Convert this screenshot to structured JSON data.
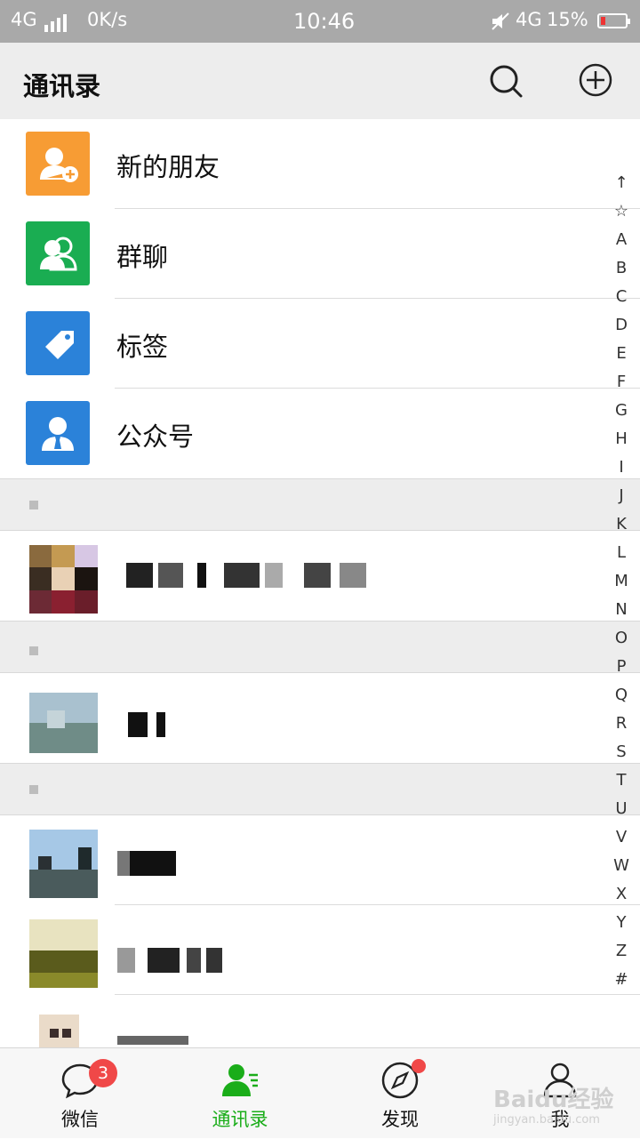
{
  "status_bar": {
    "network_left": "4G",
    "speed": "0K/s",
    "time": "10:46",
    "network_right": "4G",
    "battery": "15%"
  },
  "header": {
    "title": "通讯录",
    "search_icon": "search-icon",
    "add_icon": "plus-circle-icon"
  },
  "functions": [
    {
      "label": "新的朋友",
      "color": "#f79c34",
      "icon": "add-friend-icon"
    },
    {
      "label": "群聊",
      "color": "#1aad52",
      "icon": "group-chat-icon"
    },
    {
      "label": "标签",
      "color": "#2b82d9",
      "icon": "tag-icon"
    },
    {
      "label": "公众号",
      "color": "#2b82d9",
      "icon": "official-account-icon"
    }
  ],
  "index_letters": [
    "↑",
    "☆",
    "A",
    "B",
    "C",
    "D",
    "E",
    "F",
    "G",
    "H",
    "I",
    "J",
    "K",
    "L",
    "M",
    "N",
    "O",
    "P",
    "Q",
    "R",
    "S",
    "T",
    "U",
    "V",
    "W",
    "X",
    "Y",
    "Z",
    "#"
  ],
  "tabs": [
    {
      "label": "微信",
      "icon": "chat-icon",
      "badge": "3"
    },
    {
      "label": "通讯录",
      "icon": "contacts-icon",
      "active": true
    },
    {
      "label": "发现",
      "icon": "compass-icon",
      "dot": true
    },
    {
      "label": "我",
      "icon": "profile-icon"
    }
  ],
  "colors": {
    "accent": "#1aad19",
    "badge": "#f04848",
    "header_bg": "#ededed",
    "status_bg": "#a9a9a9"
  },
  "watermark": {
    "text": "Baidu经验",
    "sub": "jingyan.baidu.com"
  }
}
